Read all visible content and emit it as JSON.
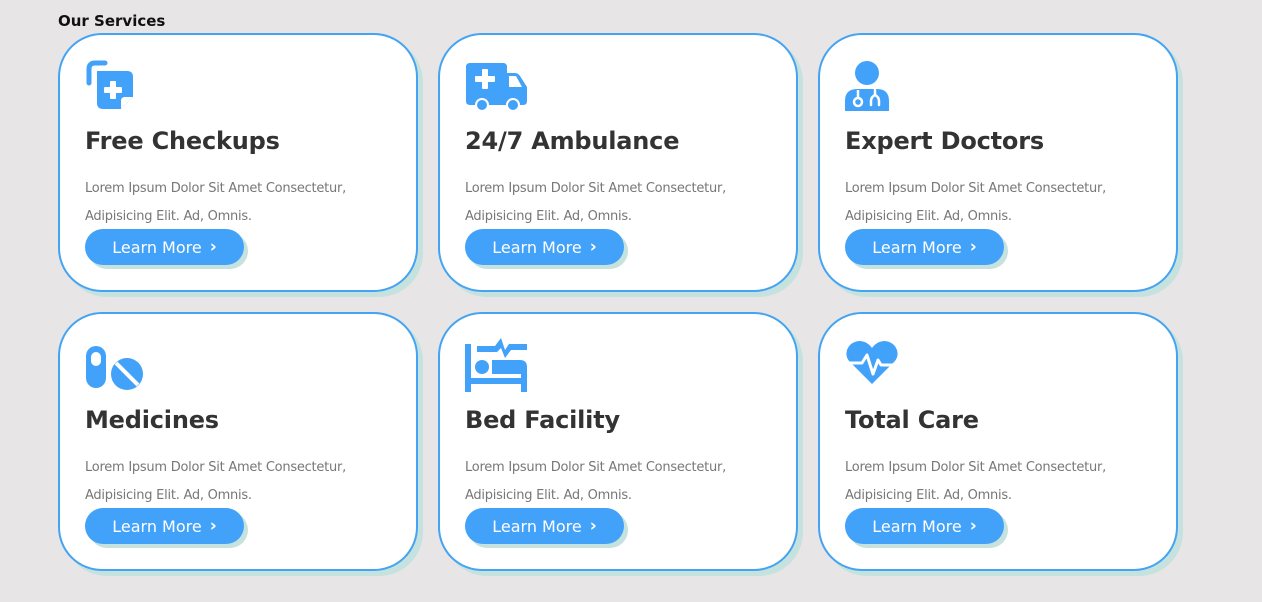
{
  "section": {
    "title": "Our Services"
  },
  "colors": {
    "accent": "#42a1f8",
    "card_border": "#44a3f2",
    "shadow": "#c5e2df",
    "background": "#e7e5e6",
    "title_text": "#333333",
    "body_text": "#777777"
  },
  "cards": [
    {
      "icon": "checkup-icon",
      "title": "Free Checkups",
      "description": "Lorem Ipsum Dolor Sit Amet Consectetur, Adipisicing Elit. Ad, Omnis.",
      "button_label": "Learn More",
      "button_icon": "chevron-right-icon"
    },
    {
      "icon": "ambulance-icon",
      "title": "24/7 Ambulance",
      "description": "Lorem Ipsum Dolor Sit Amet Consectetur, Adipisicing Elit. Ad, Omnis.",
      "button_label": "Learn More",
      "button_icon": "chevron-right-icon"
    },
    {
      "icon": "doctor-icon",
      "title": "Expert Doctors",
      "description": "Lorem Ipsum Dolor Sit Amet Consectetur, Adipisicing Elit. Ad, Omnis.",
      "button_label": "Learn More",
      "button_icon": "chevron-right-icon"
    },
    {
      "icon": "pills-icon",
      "title": "Medicines",
      "description": "Lorem Ipsum Dolor Sit Amet Consectetur, Adipisicing Elit. Ad, Omnis.",
      "button_label": "Learn More",
      "button_icon": "chevron-right-icon"
    },
    {
      "icon": "procedures-bed-icon",
      "title": "Bed Facility",
      "description": "Lorem Ipsum Dolor Sit Amet Consectetur, Adipisicing Elit. Ad, Omnis.",
      "button_label": "Learn More",
      "button_icon": "chevron-right-icon"
    },
    {
      "icon": "heartbeat-icon",
      "title": "Total Care",
      "description": "Lorem Ipsum Dolor Sit Amet Consectetur, Adipisicing Elit. Ad, Omnis.",
      "button_label": "Learn More",
      "button_icon": "chevron-right-icon"
    }
  ]
}
